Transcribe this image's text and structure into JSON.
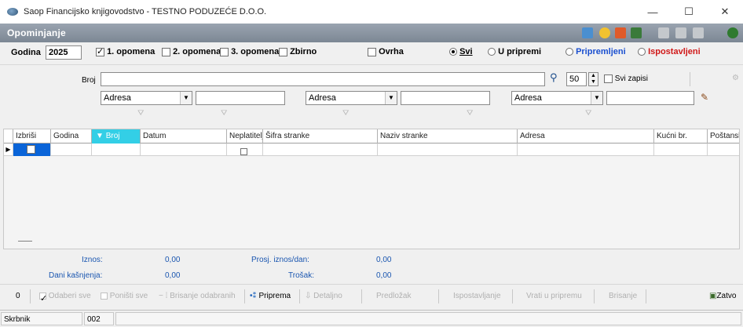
{
  "window": {
    "title": "Saop Financijsko knjigovodstvo - TESTNO PODUZEĆE D.O.O.",
    "minimize": "—",
    "maximize": "☐",
    "close": "✕"
  },
  "module": {
    "title": "Opominjanje"
  },
  "toolbar_icons": [
    "grid-icon",
    "star-icon",
    "document-icon",
    "export-icon",
    "print-icon",
    "copy-icon",
    "paste-icon",
    "exit-icon"
  ],
  "filters": {
    "godina_label": "Godina",
    "godina_value": "2025",
    "opomena1": "1. opomena",
    "opomena2": "2. opomena",
    "opomena3": "3. opomena",
    "zbirno": "Zbirno",
    "ovrha": "Ovrha",
    "svi": "Svi",
    "u_pripremi": "U pripremi",
    "pripremljeni": "Pripremljeni",
    "ispostavljeni": "Ispostavljeni"
  },
  "search": {
    "broj_label": "Broj",
    "broj_value": "",
    "count_value": "50",
    "svi_zapisi": "Svi zapisi",
    "adresa1": "Adresa",
    "adresa2": "Adresa",
    "adresa3": "Adresa"
  },
  "grid": {
    "columns": [
      "Izbriši",
      "Godina",
      "Broj",
      "Datum",
      "Neplatitelj",
      "Šifra stranke",
      "Naziv stranke",
      "Adresa",
      "Kućni br.",
      "Poštansk"
    ]
  },
  "totals": {
    "iznos_label": "Iznos:",
    "iznos_value": "0,00",
    "dani_label": "Dani kašnjenja:",
    "dani_value": "0,00",
    "prosj_label": "Prosj. iznos/dan:",
    "prosj_value": "0,00",
    "trosak_label": "Trošak:",
    "trosak_value": "0,00"
  },
  "actions": {
    "counter": "0",
    "odaberi_sve": "Odaberi sve",
    "ponisti_sve": "Poništi sve",
    "brisanje_odabranih": "Brisanje odabranih",
    "priprema": "Priprema",
    "detaljno": "Detaljno",
    "predlozak": "Predložak",
    "ispostavljanje": "Ispostavljanje",
    "vrati_u_pripremu": "Vrati u pripremu",
    "brisanje": "Brisanje",
    "zatvori": "Zatvo"
  },
  "status": {
    "user": "Skrbnik",
    "code": "002"
  }
}
